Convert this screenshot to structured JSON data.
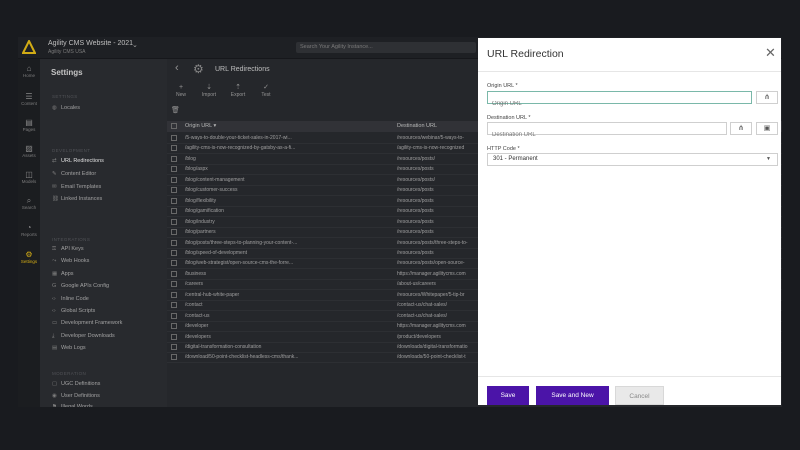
{
  "topbar": {
    "site_title": "Agility CMS Website - 2021",
    "site_sub": "Agility CMS USA",
    "search_placeholder": "Search Your Agility Instance..."
  },
  "rail": [
    {
      "icon": "home-icon",
      "glyph": "⌂",
      "label": "Home"
    },
    {
      "icon": "content-icon",
      "glyph": "☰",
      "label": "Content"
    },
    {
      "icon": "pages-icon",
      "glyph": "▤",
      "label": "Pages"
    },
    {
      "icon": "assets-icon",
      "glyph": "▨",
      "label": "Assets"
    },
    {
      "icon": "models-icon",
      "glyph": "◫",
      "label": "Models"
    },
    {
      "icon": "search-icon",
      "glyph": "⌕",
      "label": "Search"
    },
    {
      "icon": "reports-icon",
      "glyph": "◔",
      "label": "Reports"
    },
    {
      "icon": "settings-icon",
      "glyph": "⚙",
      "label": "Settings"
    }
  ],
  "settings": {
    "title": "Settings",
    "sections": [
      {
        "title": "SETTINGS",
        "items": [
          {
            "label": "Locales",
            "icon": "globe-icon",
            "glyph": "◍"
          }
        ]
      },
      {
        "title": "DEVELOPMENT",
        "items": [
          {
            "label": "URL Redirections",
            "icon": "redirect-icon",
            "glyph": "⇄"
          },
          {
            "label": "Content Editor",
            "icon": "editor-icon",
            "glyph": "✎"
          },
          {
            "label": "Email Templates",
            "icon": "email-icon",
            "glyph": "✉"
          },
          {
            "label": "Linked Instances",
            "icon": "link-icon",
            "glyph": "⛓"
          }
        ]
      },
      {
        "title": "INTEGRATIONS",
        "items": [
          {
            "label": "API Keys",
            "icon": "key-icon",
            "glyph": "⚿"
          },
          {
            "label": "Web Hooks",
            "icon": "webhook-icon",
            "glyph": "⤳"
          },
          {
            "label": "Apps",
            "icon": "apps-icon",
            "glyph": "▦"
          },
          {
            "label": "Google APIs Config",
            "icon": "google-icon",
            "glyph": "G"
          },
          {
            "label": "Inline Code",
            "icon": "code-icon",
            "glyph": "‹›"
          },
          {
            "label": "Global Scripts",
            "icon": "script-icon",
            "glyph": "‹›"
          },
          {
            "label": "Development Framework",
            "icon": "framework-icon",
            "glyph": "▭"
          },
          {
            "label": "Developer Downloads",
            "icon": "download-icon",
            "glyph": "⤓"
          },
          {
            "label": "Web Logs",
            "icon": "logs-icon",
            "glyph": "▤"
          }
        ]
      },
      {
        "title": "MODERATION",
        "items": [
          {
            "label": "UGC Definitions",
            "icon": "ugc-icon",
            "glyph": "▢"
          },
          {
            "label": "User Definitions",
            "icon": "user-icon",
            "glyph": "◉"
          },
          {
            "label": "Illegal Words",
            "icon": "flag-icon",
            "glyph": "⚑"
          }
        ]
      }
    ]
  },
  "main": {
    "title": "URL Redirections",
    "toolbar": [
      {
        "label": "New",
        "icon": "plus-icon",
        "glyph": "+"
      },
      {
        "label": "Import",
        "icon": "import-icon",
        "glyph": "⇣"
      },
      {
        "label": "Export",
        "icon": "export-icon",
        "glyph": "⇡"
      },
      {
        "label": "Test",
        "icon": "test-icon",
        "glyph": "✓"
      }
    ],
    "columns": {
      "origin": "Origin URL ▾",
      "destination": "Destination URL"
    },
    "rows": [
      {
        "origin": "/5-ways-to-double-your-ticket-sales-in-2017-wi...",
        "destination": "/resources/webinar/5-ways-to-"
      },
      {
        "origin": "/agility-cms-is-now-recognized-by-gatsby-as-a-fi...",
        "destination": "/agility-cms-is-now-recognized"
      },
      {
        "origin": "/blog",
        "destination": "/resources/posts/"
      },
      {
        "origin": "/blog/aspx",
        "destination": "/resources/posts"
      },
      {
        "origin": "/blog/content-management",
        "destination": "/resources/posts/"
      },
      {
        "origin": "/blog/customer-success",
        "destination": "/resources/posts"
      },
      {
        "origin": "/blog/flexibility",
        "destination": "/resources/posts"
      },
      {
        "origin": "/blog/gamification",
        "destination": "/resources/posts"
      },
      {
        "origin": "/blog/industry",
        "destination": "/resources/posts"
      },
      {
        "origin": "/blog/partners",
        "destination": "/resources/posts"
      },
      {
        "origin": "/blog/posts/three-steps-to-planning-your-content-...",
        "destination": "/resources/posts/three-steps-to-"
      },
      {
        "origin": "/blog/speed-of-development",
        "destination": "/resources/posts"
      },
      {
        "origin": "/blog/web-strategist/open-source-cms-the-forre...",
        "destination": "/resources/posts/open-source-"
      },
      {
        "origin": "/business",
        "destination": "https://manager.agilitycms.com"
      },
      {
        "origin": "/careers",
        "destination": "/about-us/careers"
      },
      {
        "origin": "/central-hub-white-paper",
        "destination": "/resources/Whitepaper/5-tip-br"
      },
      {
        "origin": "/contact",
        "destination": "/contact-us/chat-sales/"
      },
      {
        "origin": "/contact-us",
        "destination": "/contact-us/chat-sales/"
      },
      {
        "origin": "/developer",
        "destination": "https://manager.agilitycms.com"
      },
      {
        "origin": "/developers",
        "destination": "/product/developers"
      },
      {
        "origin": "/digital-transformation-consultation",
        "destination": "/downloads/digital-transformatio"
      },
      {
        "origin": "/download/50-point-checklist-headless-cms/thank...",
        "destination": "/downloads/50-point-checklist-t"
      }
    ]
  },
  "panel": {
    "title": "URL Redirection",
    "origin_label": "Origin URL *",
    "origin_placeholder": "Origin URL",
    "destination_label": "Destination URL *",
    "destination_placeholder": "Destination URL",
    "http_label": "HTTP Code *",
    "http_value": "301 - Permanent",
    "save": "Save",
    "save_new": "Save and New",
    "cancel": "Cancel"
  },
  "colors": {
    "accent": "#4b14a8",
    "active_nav": "#f0c419"
  }
}
